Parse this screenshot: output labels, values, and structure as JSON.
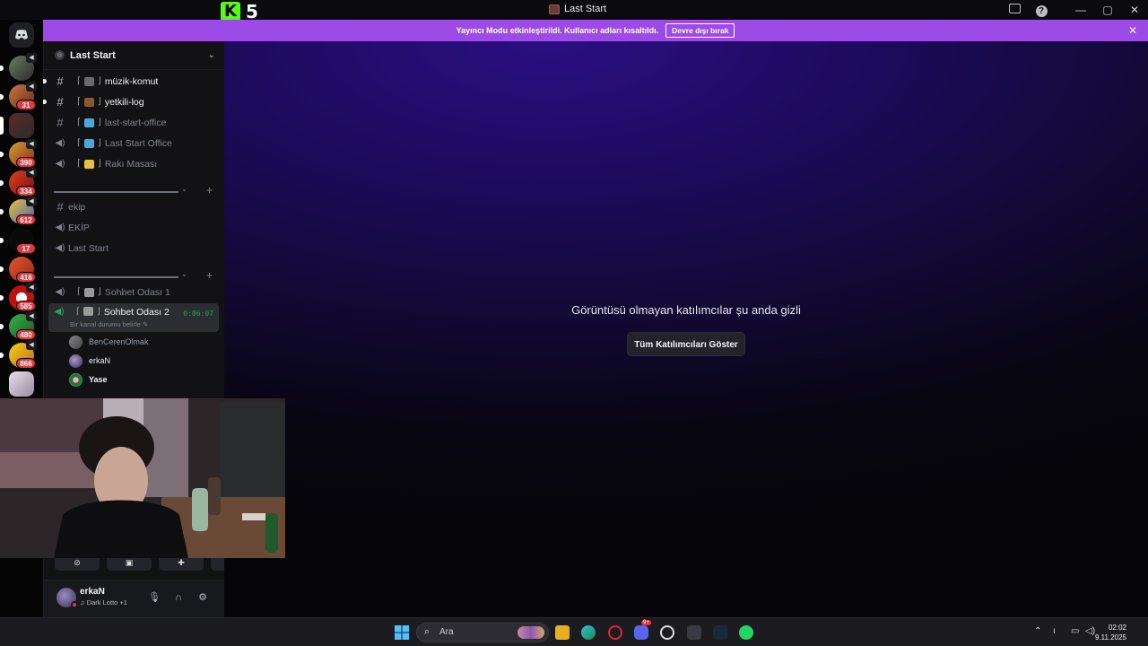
{
  "window": {
    "title": "Last Start",
    "kick_count": "5",
    "kick_logo": "K"
  },
  "banner": {
    "text": "Yayıncı Modu etkinleştirildi. Kullanıcı adları kısaltıldı.",
    "disable_label": "Devre dışı bırak",
    "color": "#9c4be6"
  },
  "rail": {
    "badges": [
      "31",
      "390",
      "334",
      "612",
      "17",
      "416",
      "585",
      "480",
      "866"
    ]
  },
  "guild": {
    "name": "Last Start"
  },
  "channels": {
    "top": [
      {
        "kind": "text",
        "name": "müzik-komut",
        "unread": true
      },
      {
        "kind": "text",
        "name": "yetkili-log",
        "unread": true
      },
      {
        "kind": "text",
        "name": "last-start-office",
        "unread": false
      },
      {
        "kind": "voice",
        "name": "Last Start Office",
        "unread": false
      },
      {
        "kind": "voice",
        "name": "Rakı Masası",
        "unread": false
      }
    ],
    "mid": [
      {
        "kind": "text",
        "name": "ekip"
      },
      {
        "kind": "voice",
        "name": "EKİP"
      },
      {
        "kind": "voice",
        "name": "Last Start"
      }
    ],
    "bottom": [
      {
        "kind": "voice",
        "name": "Sohbet Odası 1"
      },
      {
        "kind": "voice",
        "name": "Sohbet Odası 2",
        "timer": "0:06:07",
        "status": "Bir kanal durumu belirle"
      }
    ],
    "voice_users": [
      "BenCerenOlmak",
      "erkaN",
      "Yase"
    ]
  },
  "user_panel": {
    "name": "erkaN",
    "activity": "Dark Lotto +1"
  },
  "stage": {
    "message": "Görüntüsü olmayan katılımcılar şu anda gizli",
    "button": "Tüm Katılımcıları Göster"
  },
  "taskbar": {
    "search_placeholder": "Ara",
    "time": "02:02",
    "date": "9.11.2025",
    "discord_badge": "9+"
  }
}
